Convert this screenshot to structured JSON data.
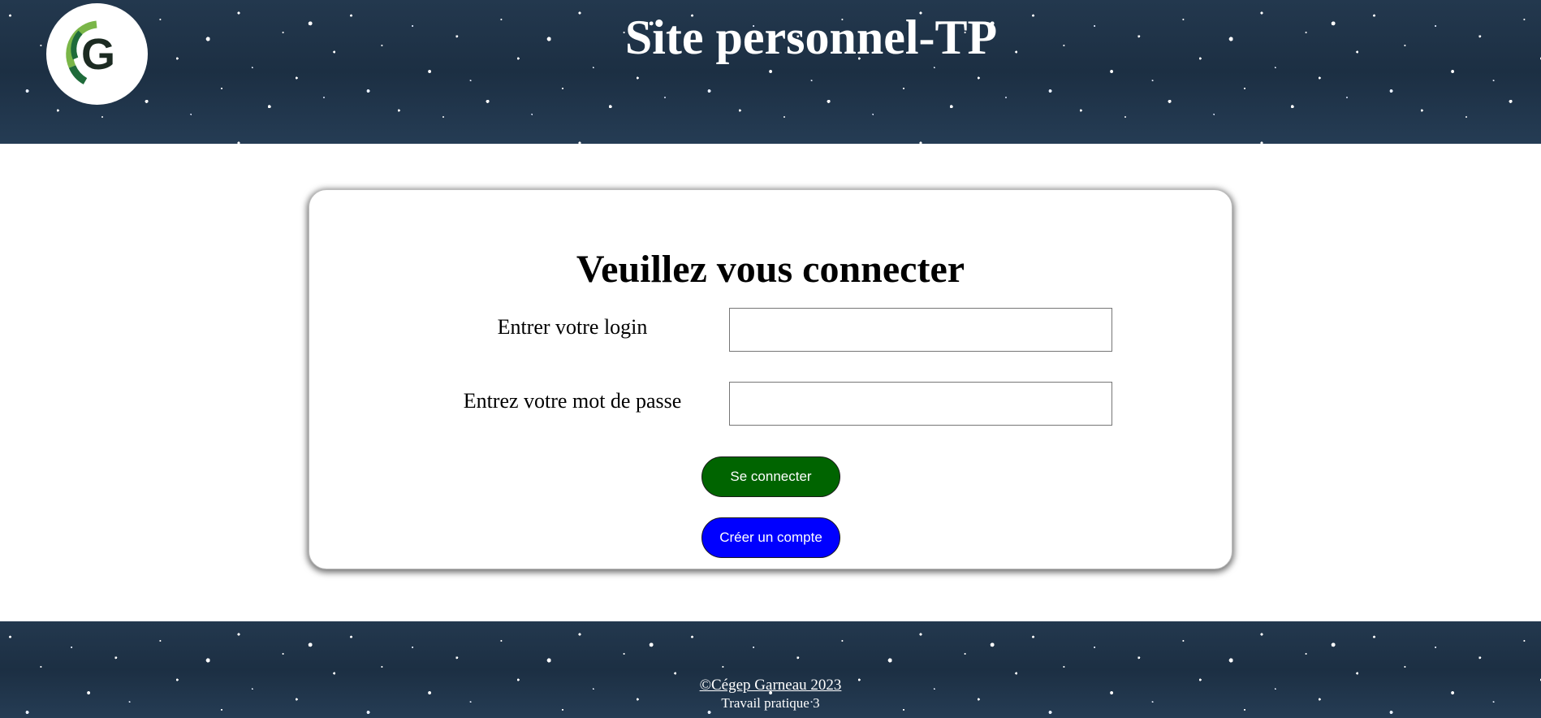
{
  "header": {
    "title": "Site personnel-TP",
    "logo_icon": "cegep-garneau-logo",
    "logo_letter": "G"
  },
  "login_card": {
    "heading": "Veuillez vous connecter",
    "login_label": "Entrer votre login",
    "login_value": "",
    "password_label": "Entrez votre mot de passe",
    "password_value": "",
    "submit_label": "Se connecter",
    "create_label": "Créer un compte"
  },
  "footer": {
    "copyright": "©Cégep Garneau 2023",
    "subtitle": "Travail pratique 3"
  },
  "colors": {
    "submit_button": "#006400",
    "create_button": "#0000ff",
    "header_bg": "#1f3347",
    "logo_green_light": "#7ab648",
    "logo_green_dark": "#1f6b3a",
    "logo_letter": "#1c2b22"
  }
}
